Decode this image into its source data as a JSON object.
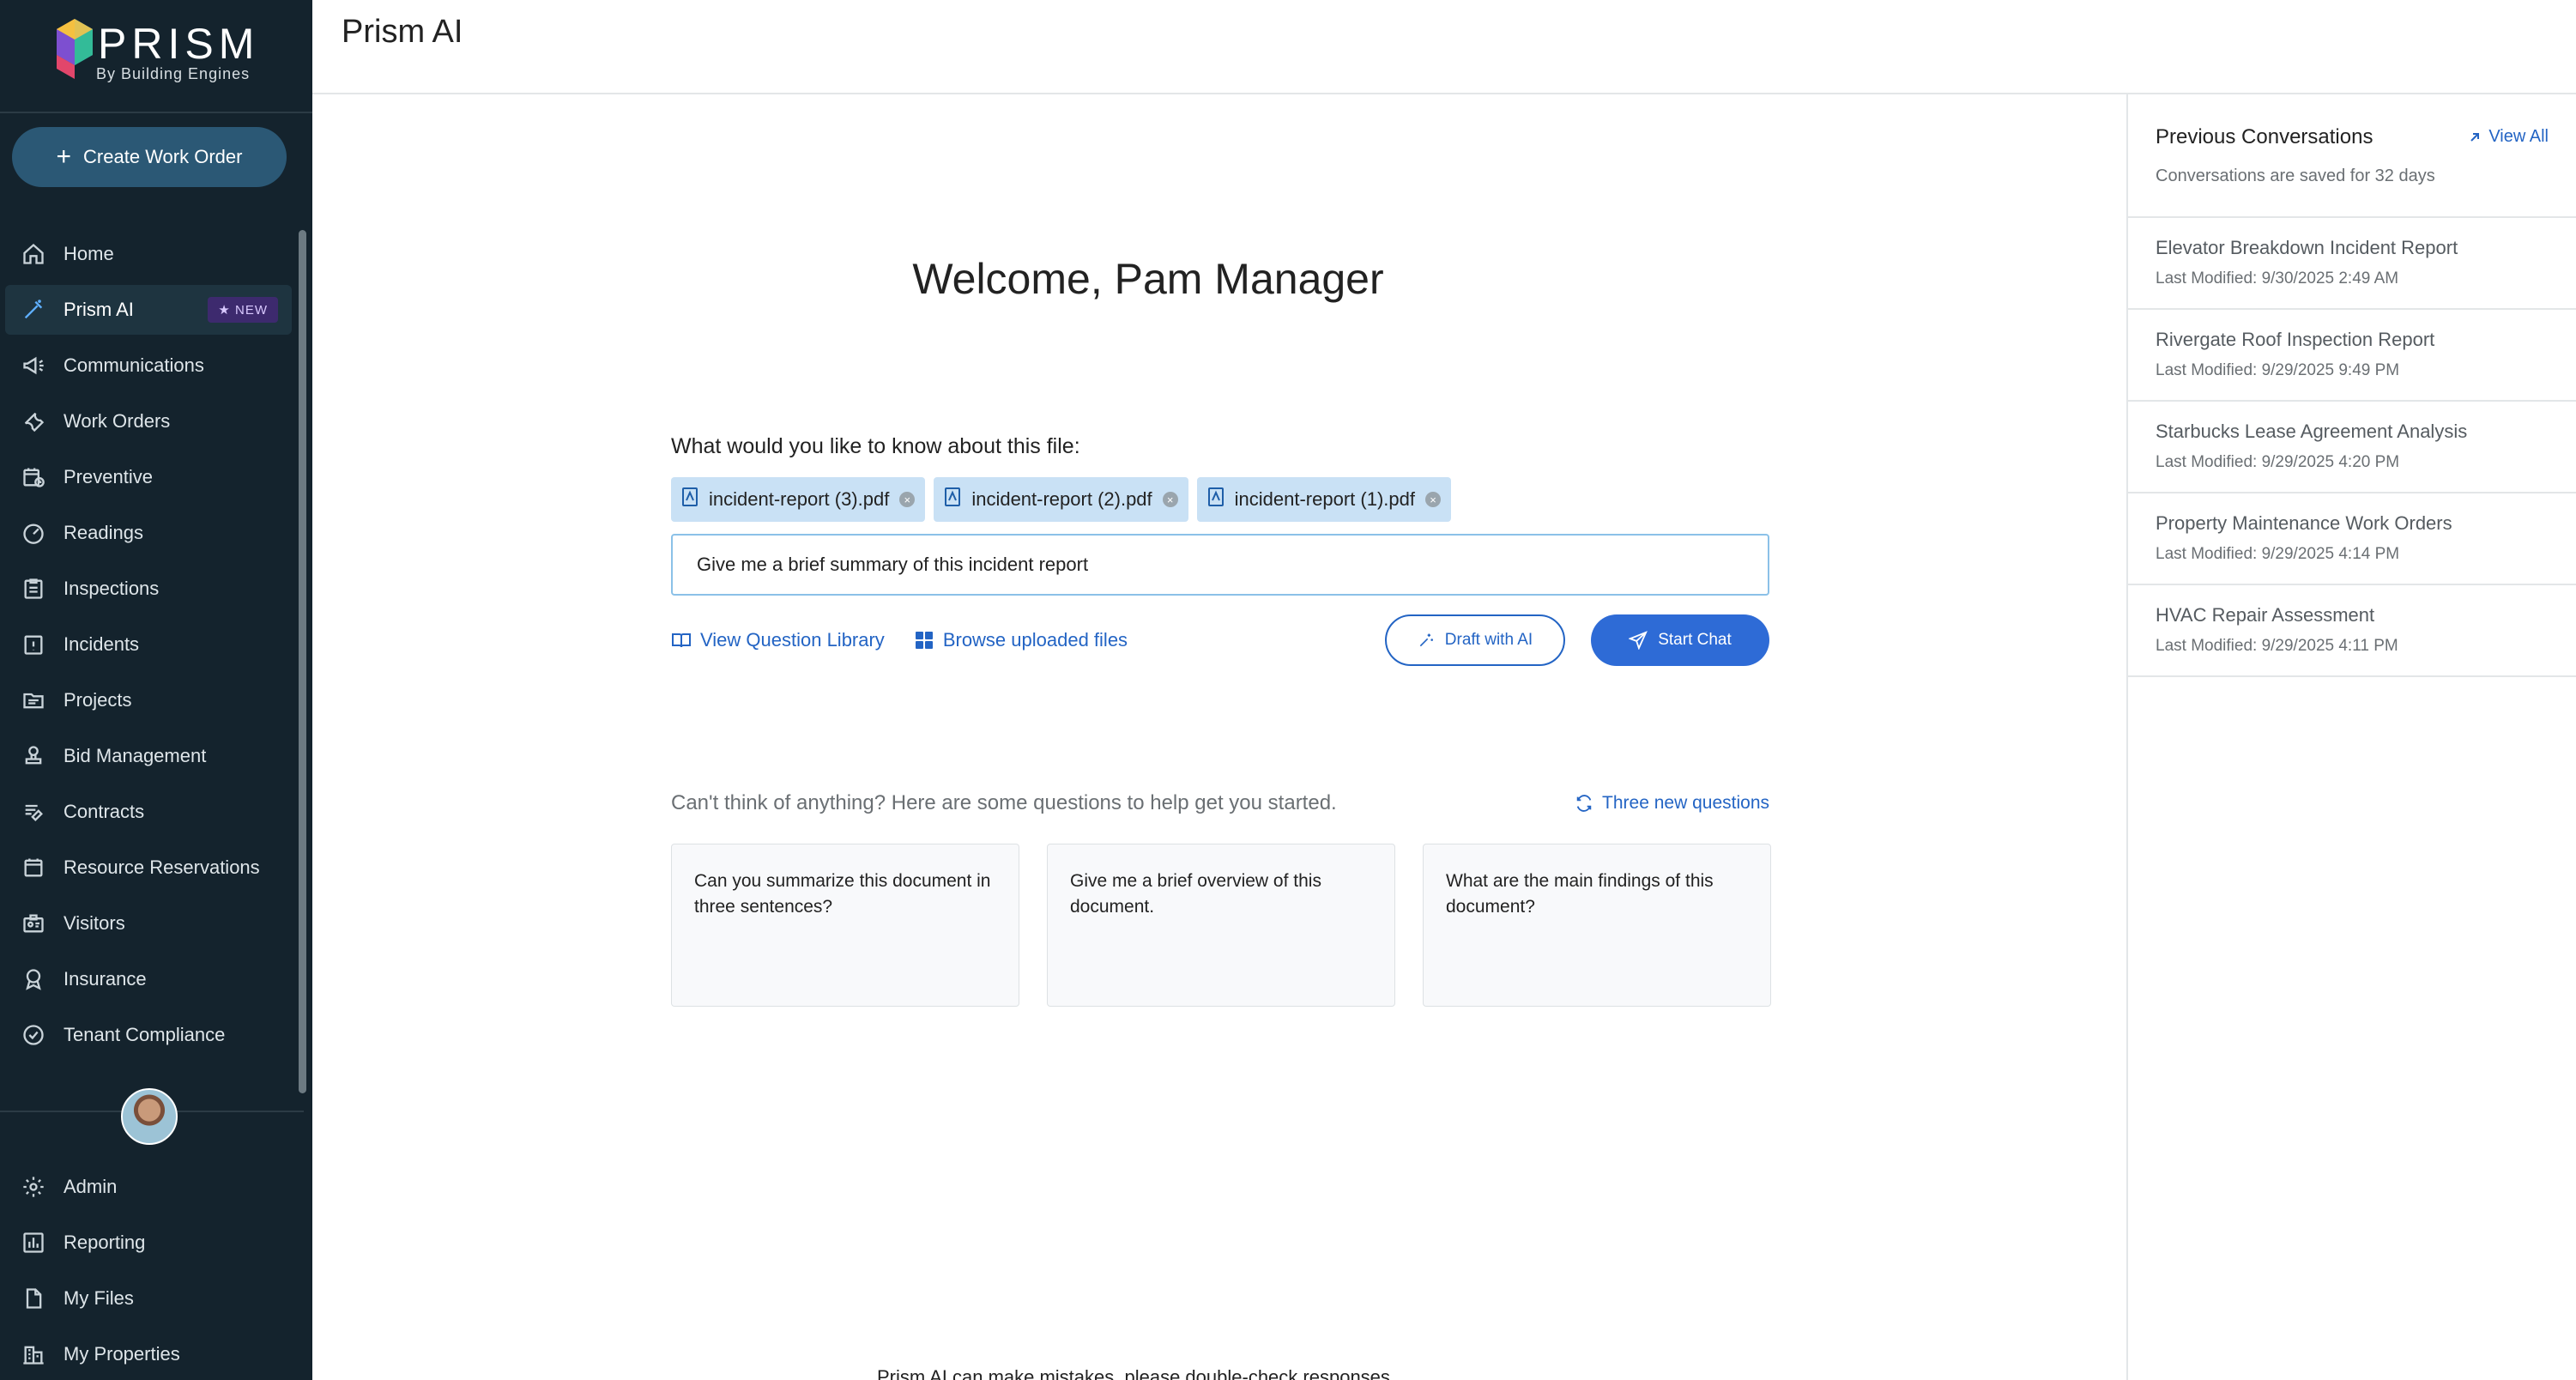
{
  "app": {
    "logo_word": "PRISM",
    "logo_sub": "By Building Engines",
    "page_title": "Prism AI"
  },
  "sidebar": {
    "create_button": "Create Work Order",
    "items": [
      {
        "label": "Home",
        "icon": "home-icon"
      },
      {
        "label": "Prism AI",
        "icon": "magic-wand-icon",
        "badge": "NEW",
        "active": true
      },
      {
        "label": "Communications",
        "icon": "megaphone-icon"
      },
      {
        "label": "Work Orders",
        "icon": "wrench-icon"
      },
      {
        "label": "Preventive",
        "icon": "calendar-clock-icon"
      },
      {
        "label": "Readings",
        "icon": "gauge-icon"
      },
      {
        "label": "Inspections",
        "icon": "clipboard-icon"
      },
      {
        "label": "Incidents",
        "icon": "alert-clipboard-icon"
      },
      {
        "label": "Projects",
        "icon": "folder-icon"
      },
      {
        "label": "Bid Management",
        "icon": "stamp-icon"
      },
      {
        "label": "Contracts",
        "icon": "contract-icon"
      },
      {
        "label": "Resource Reservations",
        "icon": "calendar-icon"
      },
      {
        "label": "Visitors",
        "icon": "badge-icon"
      },
      {
        "label": "Insurance",
        "icon": "ribbon-icon"
      },
      {
        "label": "Tenant Compliance",
        "icon": "check-badge-icon"
      }
    ],
    "lower_items": [
      {
        "label": "Admin",
        "icon": "gear-icon"
      },
      {
        "label": "Reporting",
        "icon": "bar-chart-icon"
      },
      {
        "label": "My Files",
        "icon": "file-icon"
      },
      {
        "label": "My Properties",
        "icon": "building-icon"
      }
    ]
  },
  "main": {
    "welcome": "Welcome, Pam Manager",
    "ask_label": "What would you like to know about this file:",
    "files": [
      "incident-report (3).pdf",
      "incident-report (2).pdf",
      "incident-report (1).pdf"
    ],
    "prompt_value": "Give me a brief summary of this incident report",
    "view_library": "View Question Library",
    "browse_files": "Browse uploaded files",
    "draft_ai": "Draft with AI",
    "start_chat": "Start Chat",
    "suggest_text": "Can't think of anything? Here are some questions to help get you started.",
    "refresh": "Three new questions",
    "suggestions": [
      "Can you summarize this document in three sentences?",
      "Give me a brief overview of this document.",
      "What are the main findings of this document?"
    ],
    "disclaimer": "Prism AI can make mistakes, please double-check responses."
  },
  "previous": {
    "title": "Previous Conversations",
    "view_all": "View All",
    "subtitle": "Conversations are saved for 32 days",
    "items": [
      {
        "title": "Elevator Breakdown Incident Report",
        "date": "Last Modified: 9/30/2025 2:49 AM"
      },
      {
        "title": "Rivergate Roof Inspection Report",
        "date": "Last Modified: 9/29/2025 9:49 PM"
      },
      {
        "title": "Starbucks Lease Agreement Analysis",
        "date": "Last Modified: 9/29/2025 4:20 PM"
      },
      {
        "title": "Property Maintenance Work Orders",
        "date": "Last Modified: 9/29/2025 4:14 PM"
      },
      {
        "title": "HVAC Repair Assessment",
        "date": "Last Modified: 9/29/2025 4:11 PM"
      }
    ]
  },
  "colors": {
    "sidebar_bg": "#14232d",
    "accent": "#2e6bd6",
    "link": "#2364c4",
    "chip_bg": "#c9e1f5",
    "badge_bg": "#3d2a6e"
  }
}
